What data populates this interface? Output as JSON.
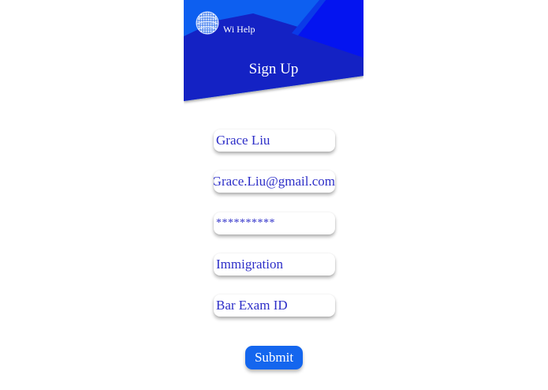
{
  "header": {
    "app_name": "Wi Help",
    "logo_icon": "globe-icon",
    "page_title": "Sign Up",
    "colors": {
      "light_blue": "#0d5ff0",
      "dark_blue": "#1422c4",
      "bright_blue": "#0414f0"
    }
  },
  "form": {
    "name_value": "Grace Liu",
    "email_value": "Grace.Liu@gmail.com",
    "password_value": "**********",
    "practice_area_value": "Immigration",
    "bar_exam_placeholder": "Bar Exam ID",
    "submit_label": "Submit",
    "text_color": "#2d2ec8",
    "button_color": "#1466ee"
  }
}
